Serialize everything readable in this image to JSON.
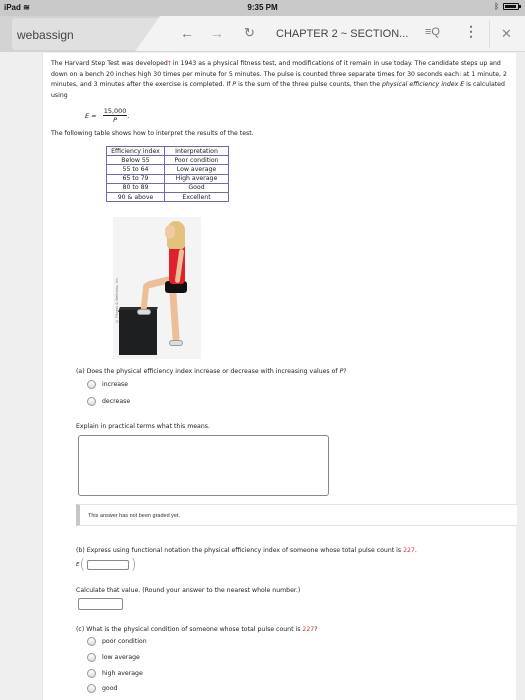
{
  "status_bar": {
    "device": "iPad",
    "wifi_icon": "wifi-icon",
    "time": "9:35 PM",
    "bluetooth_icon": "bluetooth-icon",
    "battery_icon": "battery-icon"
  },
  "browser": {
    "tab_label": "webassign",
    "back_icon": "←",
    "forward_icon": "→",
    "reload_icon": "↻",
    "page_title": "CHAPTER 2 ~ SECTION...",
    "find_icon": "☰🔍",
    "menu_icon": "⋮",
    "close_icon": "✕"
  },
  "problem": {
    "intro_1": "The Harvard Step Test was developed",
    "dagger": "†",
    "intro_2": " in 1943 as a physical fitness test, and modifications of it remain in use today. The candidate steps up and down on a bench 20 inches high 30 times per minute for 5 minutes. The pulse is counted three separate times for 30 seconds each: at 1 minute, 2 minutes, and 3 minutes after the exercise is completed. If ",
    "p_var": "P",
    "intro_3": " is the sum of the three pulse counts, then the ",
    "term": "physical efficiency index E",
    "intro_4": " is calculated using",
    "formula": {
      "lhs": "E",
      "eq": " = ",
      "numerator": "15,000",
      "denominator": "P",
      "trail": "."
    },
    "table_intro": "The following table shows how to interpret the results of the test.",
    "table": {
      "headers": [
        "Efficiency index",
        "Interpretation"
      ],
      "rows": [
        [
          "Below 55",
          "Poor condition"
        ],
        [
          "55 to 64",
          "Low average"
        ],
        [
          "65 to 79",
          "High average"
        ],
        [
          "80 to 89",
          "Good"
        ],
        [
          "90 & above",
          "Excellent"
        ]
      ]
    },
    "photo_credit": "© Fitness & Wellness, Inc."
  },
  "part_a": {
    "question": "(a) Does the physical efficiency index increase or decrease with increasing values of ",
    "question_var": "P",
    "question_end": "?",
    "options": [
      "increase",
      "decrease"
    ],
    "explain_label": "Explain in practical terms what this means.",
    "explain_value": "",
    "graded_note": "This answer has not been graded yet."
  },
  "part_b": {
    "question": "(b) Express using functional notation the physical efficiency index of someone whose total pulse count is ",
    "pulse_count": "227",
    "question_end": ".",
    "fn_name": "E",
    "fn_open": "(",
    "fn_close": ")",
    "fn_input_value": "",
    "calc_label": "Calculate that value. (Round your answer to the nearest whole number.)",
    "calc_input_value": ""
  },
  "part_c": {
    "question": "(c) What is the physical condition of someone whose total pulse count is ",
    "pulse_count": "227",
    "question_end": "?",
    "options": [
      "poor condition",
      "low average",
      "high average",
      "good"
    ]
  }
}
